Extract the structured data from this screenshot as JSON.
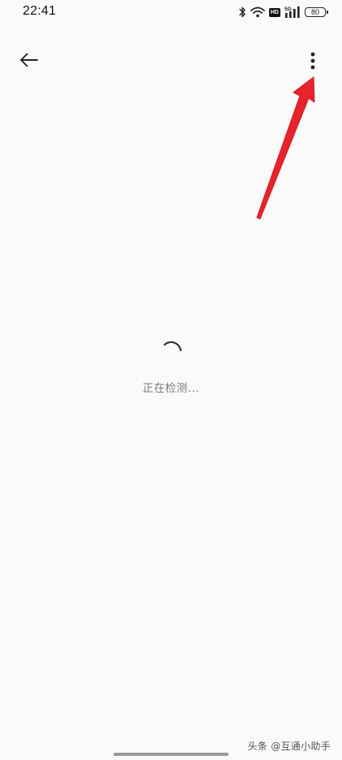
{
  "status_bar": {
    "time": "22:41",
    "network_label": "5G",
    "hd_label": "HD",
    "battery_level": "80",
    "icons": [
      "bluetooth-icon",
      "wifi-icon",
      "hd-icon",
      "cellular-signal-icon",
      "battery-icon"
    ]
  },
  "app_bar": {
    "back_icon": "arrow-left-icon",
    "menu_icon": "more-vertical-icon"
  },
  "loading": {
    "text": "正在检测..."
  },
  "watermark": {
    "text": "头条 @互通小助手"
  },
  "annotation": {
    "arrow_color": "#e8232b"
  }
}
